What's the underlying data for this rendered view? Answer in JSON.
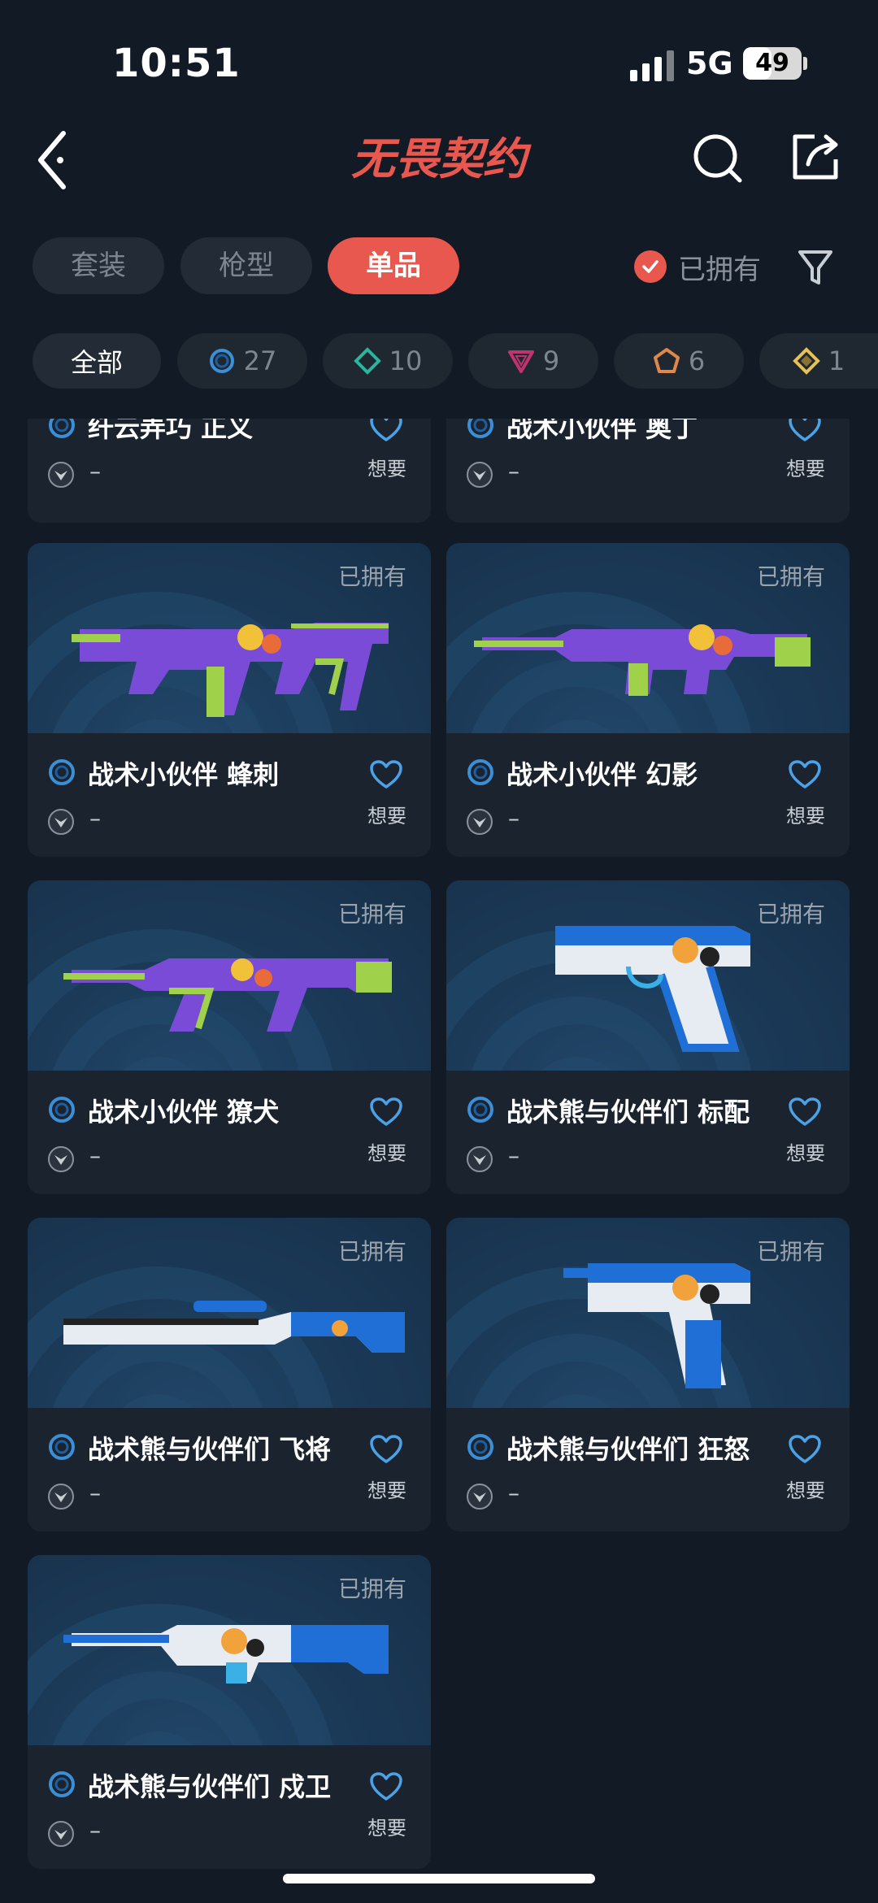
{
  "status": {
    "time": "10:51",
    "network": "5G",
    "battery": "49",
    "battery_level": 0.49
  },
  "header": {
    "logo_text": "无畏契约"
  },
  "tabs": [
    {
      "label": "套装",
      "active": false
    },
    {
      "label": "枪型",
      "active": false
    },
    {
      "label": "单品",
      "active": true
    }
  ],
  "owned_filter": {
    "label": "已拥有",
    "checked": true
  },
  "chips": [
    {
      "label": "全部",
      "icon": ""
    },
    {
      "label": "27",
      "icon": "select-tier-icon",
      "color": "#3a8fd6"
    },
    {
      "label": "10",
      "icon": "deluxe-tier-icon",
      "color": "#2bb59a"
    },
    {
      "label": "9",
      "icon": "premium-tier-icon",
      "color": "#c0346e"
    },
    {
      "label": "6",
      "icon": "exclusive-tier-icon",
      "color": "#e0884a"
    },
    {
      "label": "1",
      "icon": "ultra-tier-icon",
      "color": "#e6c156"
    }
  ],
  "cards": [
    {
      "name": "纤云弄巧 正义",
      "tier": "–",
      "want": "想要",
      "owned": "",
      "weapon": ""
    },
    {
      "name": "战术小伙伴 奥丁",
      "tier": "–",
      "want": "想要",
      "owned": "",
      "weapon": ""
    },
    {
      "name": "战术小伙伴 蜂刺",
      "tier": "–",
      "want": "想要",
      "owned": "已拥有",
      "weapon": "smg",
      "theme": "purple"
    },
    {
      "name": "战术小伙伴 幻影",
      "tier": "–",
      "want": "想要",
      "owned": "已拥有",
      "weapon": "rifle",
      "theme": "purple"
    },
    {
      "name": "战术小伙伴 獠犬",
      "tier": "–",
      "want": "想要",
      "owned": "已拥有",
      "weapon": "bullpup",
      "theme": "purple"
    },
    {
      "name": "战术熊与伙伴们 标配",
      "tier": "–",
      "want": "想要",
      "owned": "已拥有",
      "weapon": "pistol",
      "theme": "blue"
    },
    {
      "name": "战术熊与伙伴们 飞将",
      "tier": "–",
      "want": "想要",
      "owned": "已拥有",
      "weapon": "sniper",
      "theme": "blue"
    },
    {
      "name": "战术熊与伙伴们 狂怒",
      "tier": "–",
      "want": "想要",
      "owned": "已拥有",
      "weapon": "machinepistol",
      "theme": "blue"
    },
    {
      "name": "战术熊与伙伴们 戍卫",
      "tier": "–",
      "want": "想要",
      "owned": "已拥有",
      "weapon": "marksman",
      "theme": "blue"
    }
  ],
  "colors": {
    "accent": "#e8584f",
    "heart": "#4aa3e8",
    "bg": "#121a26"
  }
}
